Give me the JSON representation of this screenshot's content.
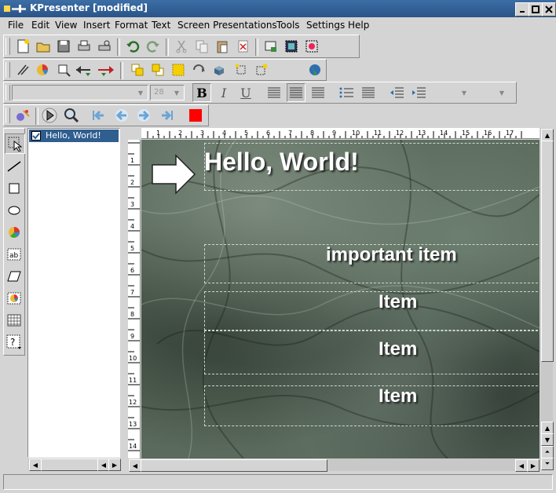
{
  "window": {
    "title": "KPresenter [modified]"
  },
  "menubar": {
    "items": [
      "File",
      "Edit",
      "View",
      "Insert",
      "Format",
      "Text",
      "Screen Presentations",
      "Tools",
      "Settings",
      "Help"
    ]
  },
  "toolbar_main": {
    "icons": [
      "new-document-icon",
      "open-folder-icon",
      "save-icon",
      "print-icon",
      "print-preview-icon",
      "undo-icon",
      "redo-icon",
      "cut-icon",
      "copy-icon",
      "paste-icon",
      "delete-icon",
      "page-setup-icon",
      "insert-picture-icon",
      "insert-clipart-icon"
    ]
  },
  "toolbar_object": {
    "icons": [
      "pen-icon",
      "pie-chart-icon",
      "text-cursor-icon",
      "arrow-left-icon",
      "arrow-right-color-icon",
      "raise-icon",
      "lower-icon",
      "group-icon",
      "rotate-icon",
      "shadow-icon",
      "align-objects-icon",
      "ungroup-icon",
      "globe-icon"
    ]
  },
  "format_toolbar": {
    "font_family": "",
    "font_size": "28",
    "bold_label": "B",
    "italic_label": "I",
    "underline_label": "U"
  },
  "presentation_toolbar": {
    "icons": [
      "effect-icon",
      "play-icon",
      "zoom-icon",
      "first-page-icon",
      "previous-page-icon",
      "next-page-icon",
      "last-page-icon",
      "stop-icon"
    ]
  },
  "sidebar": {
    "items": [
      {
        "label": "Hello, World!",
        "checked": true
      }
    ]
  },
  "hruler": {
    "labels": [
      "1",
      "2",
      "3",
      "4",
      "5",
      "6",
      "7",
      "8",
      "9",
      "10",
      "11",
      "12",
      "13",
      "14",
      "15",
      "16",
      "17"
    ]
  },
  "vruler": {
    "labels": [
      "1",
      "2",
      "3",
      "4",
      "5",
      "6",
      "7",
      "8",
      "9",
      "10",
      "11",
      "12",
      "13",
      "14"
    ]
  },
  "slide": {
    "title": "Hello, World!",
    "items": [
      "important item",
      "Item",
      "Item",
      "Item"
    ]
  },
  "colors": {
    "titlebar": "#2f5e8f",
    "selection": "#2f5e8f",
    "stop": "#ff0000"
  }
}
